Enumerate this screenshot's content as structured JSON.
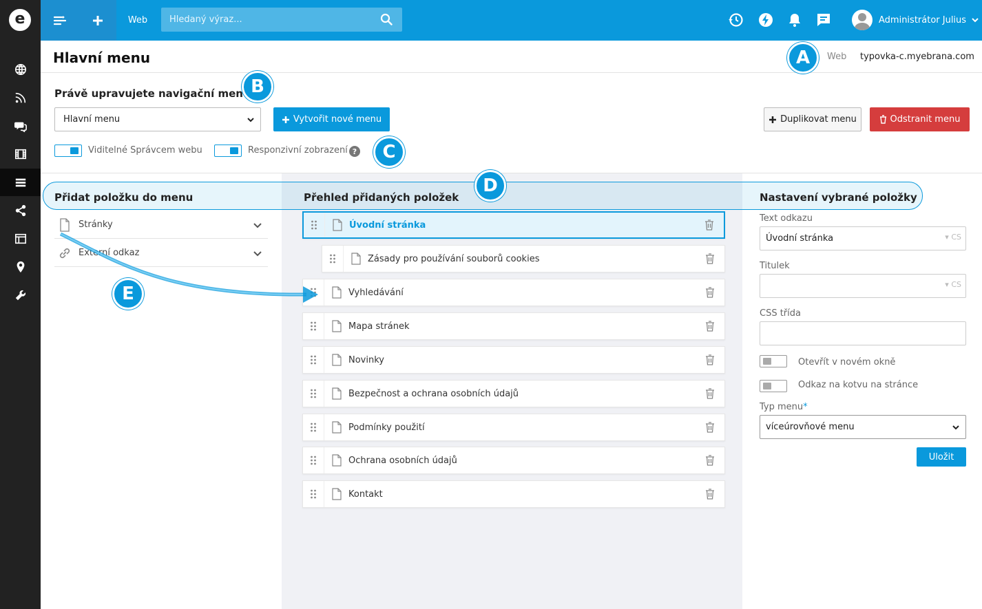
{
  "sidebar": {
    "logo_letter": "e",
    "icons": [
      "globe-icon",
      "rss-icon",
      "comments-icon",
      "film-icon",
      "menu-lines-icon",
      "share-icon",
      "layout-icon",
      "map-pin-icon",
      "wrench-icon"
    ]
  },
  "topbar": {
    "web_label": "Web",
    "search_placeholder": "Hledaný výraz...",
    "user_name": "Administrátor Julius"
  },
  "header": {
    "title": "Hlavní menu",
    "web_label": "Web",
    "domain": "typovka-c.myebrana.com"
  },
  "badges": {
    "a": "A",
    "b": "B",
    "c": "C",
    "d": "D",
    "e": "E"
  },
  "editor": {
    "editing_label": "Právě upravujete navigační menu:",
    "selected_menu": "Hlavní menu",
    "create_button": "Vytvořit nové menu",
    "duplicate_button": "Duplikovat menu",
    "delete_button": "Odstranit menu",
    "toggle_visible_label": "Viditelné Správcem webu",
    "toggle_responsive_label": "Responzivní zobrazení"
  },
  "columns": {
    "add_title": "Přidat položku do menu",
    "overview_title": "Přehled přidaných položek",
    "settings_title": "Nastavení vybrané položky"
  },
  "add_items": [
    {
      "label": "Stránky",
      "icon": "page-icon"
    },
    {
      "label": "Externí odkaz",
      "icon": "link-icon"
    }
  ],
  "menu_items": [
    {
      "label": "Úvodní stránka",
      "selected": true,
      "indent": 0
    },
    {
      "label": "Zásady pro používání souborů cookies",
      "selected": false,
      "indent": 1
    },
    {
      "label": "Vyhledávání",
      "selected": false,
      "indent": 0
    },
    {
      "label": "Mapa stránek",
      "selected": false,
      "indent": 0
    },
    {
      "label": "Novinky",
      "selected": false,
      "indent": 0
    },
    {
      "label": "Bezpečnost a ochrana osobních údajů",
      "selected": false,
      "indent": 0
    },
    {
      "label": "Podmínky použití",
      "selected": false,
      "indent": 0
    },
    {
      "label": "Ochrana osobních údajů",
      "selected": false,
      "indent": 0
    },
    {
      "label": "Kontakt",
      "selected": false,
      "indent": 0
    }
  ],
  "settings": {
    "link_text_label": "Text odkazu",
    "link_text_value": "Úvodní stránka",
    "lang_tag": "CS",
    "title_label": "Titulek",
    "title_value": "",
    "css_label": "CSS třída",
    "css_value": "",
    "new_window_label": "Otevřít v novém okně",
    "anchor_label": "Odkaz na kotvu na stránce",
    "menu_type_label": "Typ menu",
    "menu_type_required": "*",
    "menu_type_value": "víceúrovňové menu",
    "save_button": "Uložit"
  },
  "colors": {
    "accent": "#0a99dc",
    "danger": "#d53d3d",
    "sidebar": "#222222"
  }
}
